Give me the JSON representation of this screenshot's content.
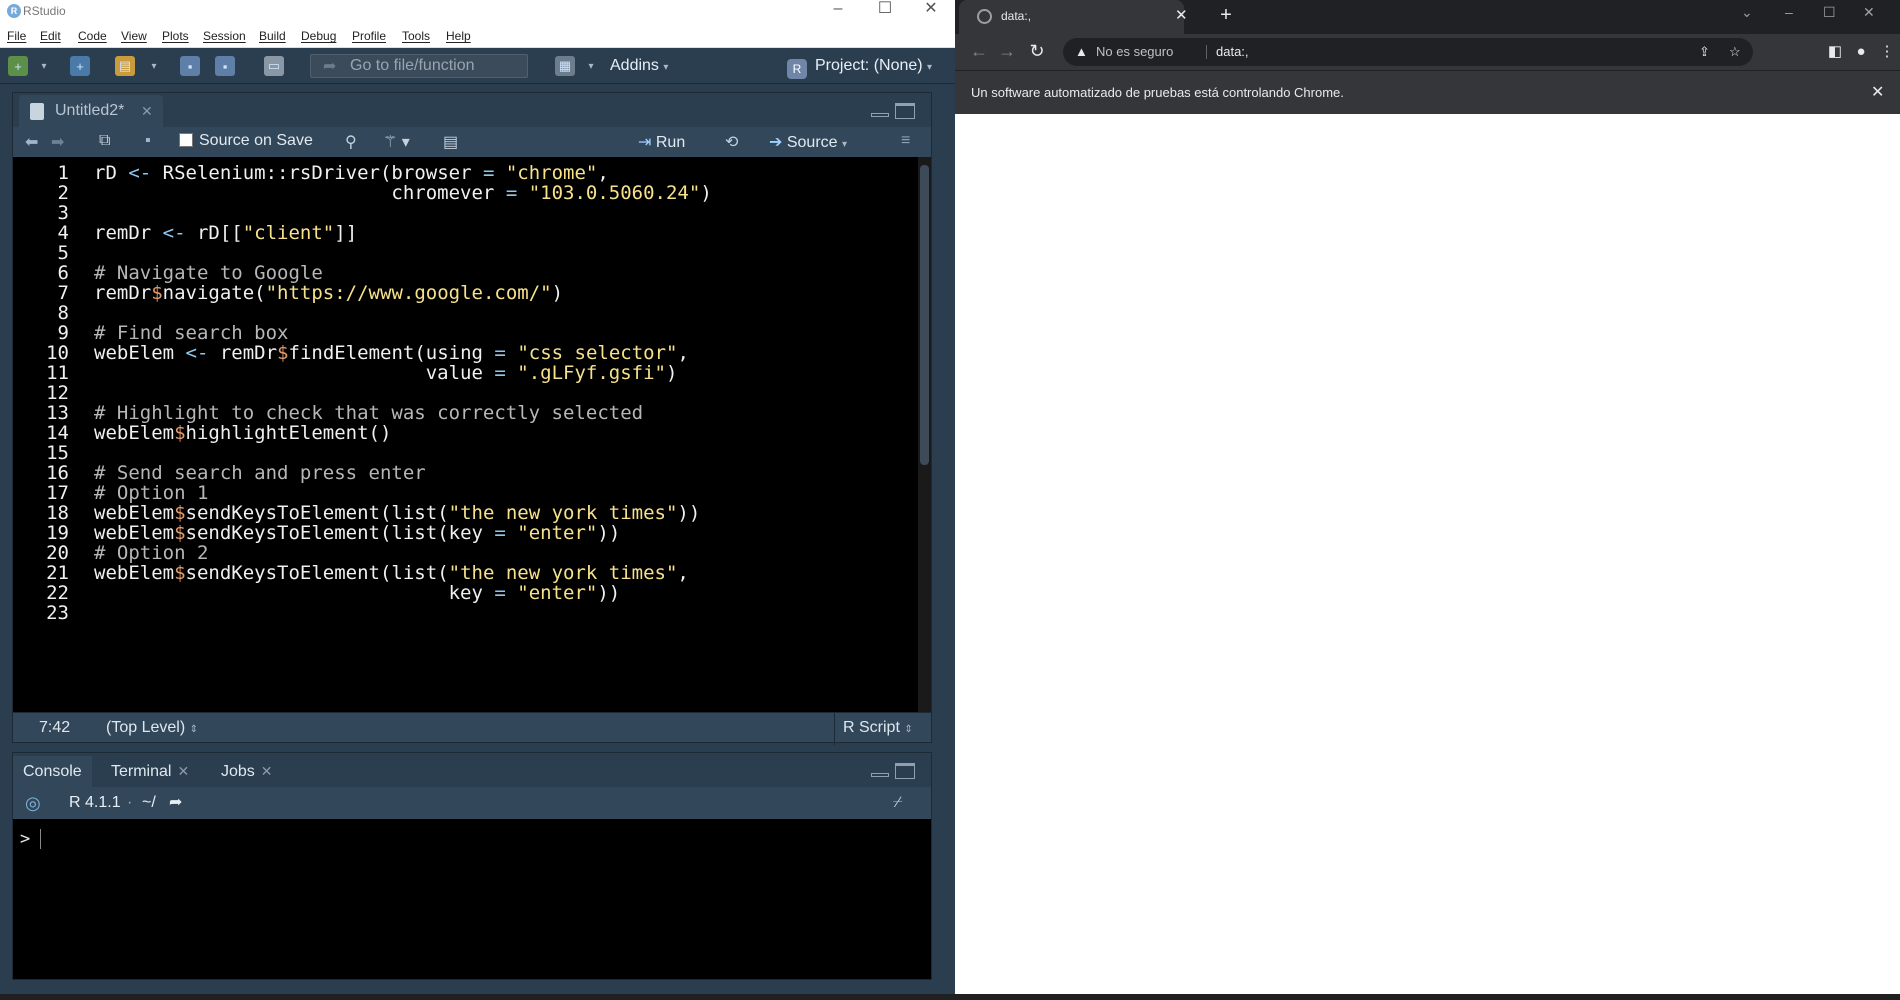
{
  "rstudio": {
    "window_title": "RStudio",
    "menu": [
      "File",
      "Edit",
      "Code",
      "View",
      "Plots",
      "Session",
      "Build",
      "Debug",
      "Profile",
      "Tools",
      "Help"
    ],
    "toolbar": {
      "goto_placeholder": "Go to file/function",
      "addins": "Addins",
      "project": "Project: (None)",
      "project_icon": "R"
    },
    "source": {
      "tab_label": "Untitled2*",
      "source_on_save": "Source on Save",
      "run_label": "Run",
      "source_label": "Source",
      "lines": [
        {
          "n": "1",
          "code": "rD <- RSelenium::rsDriver(browser = \"chrome\","
        },
        {
          "n": "2",
          "code": "                          chromever = \"103.0.5060.24\")"
        },
        {
          "n": "3",
          "code": ""
        },
        {
          "n": "4",
          "code": "remDr <- rD[[\"client\"]]"
        },
        {
          "n": "5",
          "code": ""
        },
        {
          "n": "6",
          "code": "# Navigate to Google"
        },
        {
          "n": "7",
          "code": "remDr$navigate(\"https://www.google.com/\")"
        },
        {
          "n": "8",
          "code": ""
        },
        {
          "n": "9",
          "code": "# Find search box"
        },
        {
          "n": "10",
          "code": "webElem <- remDr$findElement(using = \"css selector\","
        },
        {
          "n": "11",
          "code": "                             value = \".gLFyf.gsfi\")"
        },
        {
          "n": "12",
          "code": ""
        },
        {
          "n": "13",
          "code": "# Highlight to check that was correctly selected"
        },
        {
          "n": "14",
          "code": "webElem$highlightElement()"
        },
        {
          "n": "15",
          "code": ""
        },
        {
          "n": "16",
          "code": "# Send search and press enter"
        },
        {
          "n": "17",
          "code": "# Option 1"
        },
        {
          "n": "18",
          "code": "webElem$sendKeysToElement(list(\"the new york times\"))"
        },
        {
          "n": "19",
          "code": "webElem$sendKeysToElement(list(key = \"enter\"))"
        },
        {
          "n": "20",
          "code": "# Option 2"
        },
        {
          "n": "21",
          "code": "webElem$sendKeysToElement(list(\"the new york times\","
        },
        {
          "n": "22",
          "code": "                               key = \"enter\"))"
        },
        {
          "n": "23",
          "code": ""
        }
      ],
      "status": {
        "position": "7:42",
        "level": "(Top Level)",
        "language": "R Script"
      }
    },
    "console": {
      "tabs": [
        {
          "label": "Console",
          "closable": false
        },
        {
          "label": "Terminal",
          "closable": true
        },
        {
          "label": "Jobs",
          "closable": true
        }
      ],
      "r_version": "R 4.1.1",
      "path": "~/",
      "prompt": ">"
    }
  },
  "chrome": {
    "tab_title": "data:,",
    "omnibox": {
      "security": "No es seguro",
      "url": "data:,"
    },
    "infobar": "Un software automatizado de pruebas está controlando Chrome."
  },
  "colors": {
    "rstudio_bg": "#2b3e50",
    "editor_bg": "#000000",
    "string": "#f7e28b",
    "chrome_dark": "#35363a"
  }
}
